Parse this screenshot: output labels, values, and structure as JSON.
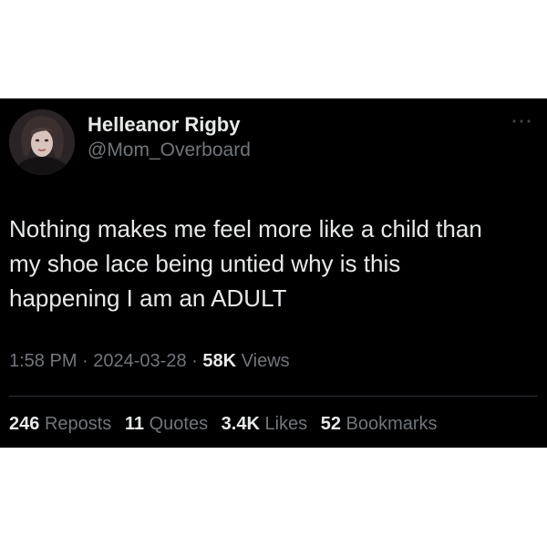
{
  "user": {
    "display_name": "Helleanor Rigby",
    "handle": "@Mom_Overboard"
  },
  "tweet": {
    "lines": [
      "Nothing makes me feel more like a child than",
      "my shoe lace being untied why is this",
      "happening I am an ADULT"
    ]
  },
  "meta": {
    "time": "1:58 PM",
    "separator": "·",
    "date": "2024-03-28",
    "views_count": "58K",
    "views_label": "Views"
  },
  "stats": [
    {
      "count": "246",
      "label": "Reposts"
    },
    {
      "count": "11",
      "label": "Quotes"
    },
    {
      "count": "3.4K",
      "label": "Likes"
    },
    {
      "count": "52",
      "label": "Bookmarks"
    }
  ],
  "icons": {
    "more": "more-horizontal-icon",
    "avatar": "profile-photo"
  },
  "colors": {
    "background": "#000000",
    "primary_text": "#e7e9ea",
    "secondary_text": "#71767b",
    "divider": "#2f3336"
  }
}
